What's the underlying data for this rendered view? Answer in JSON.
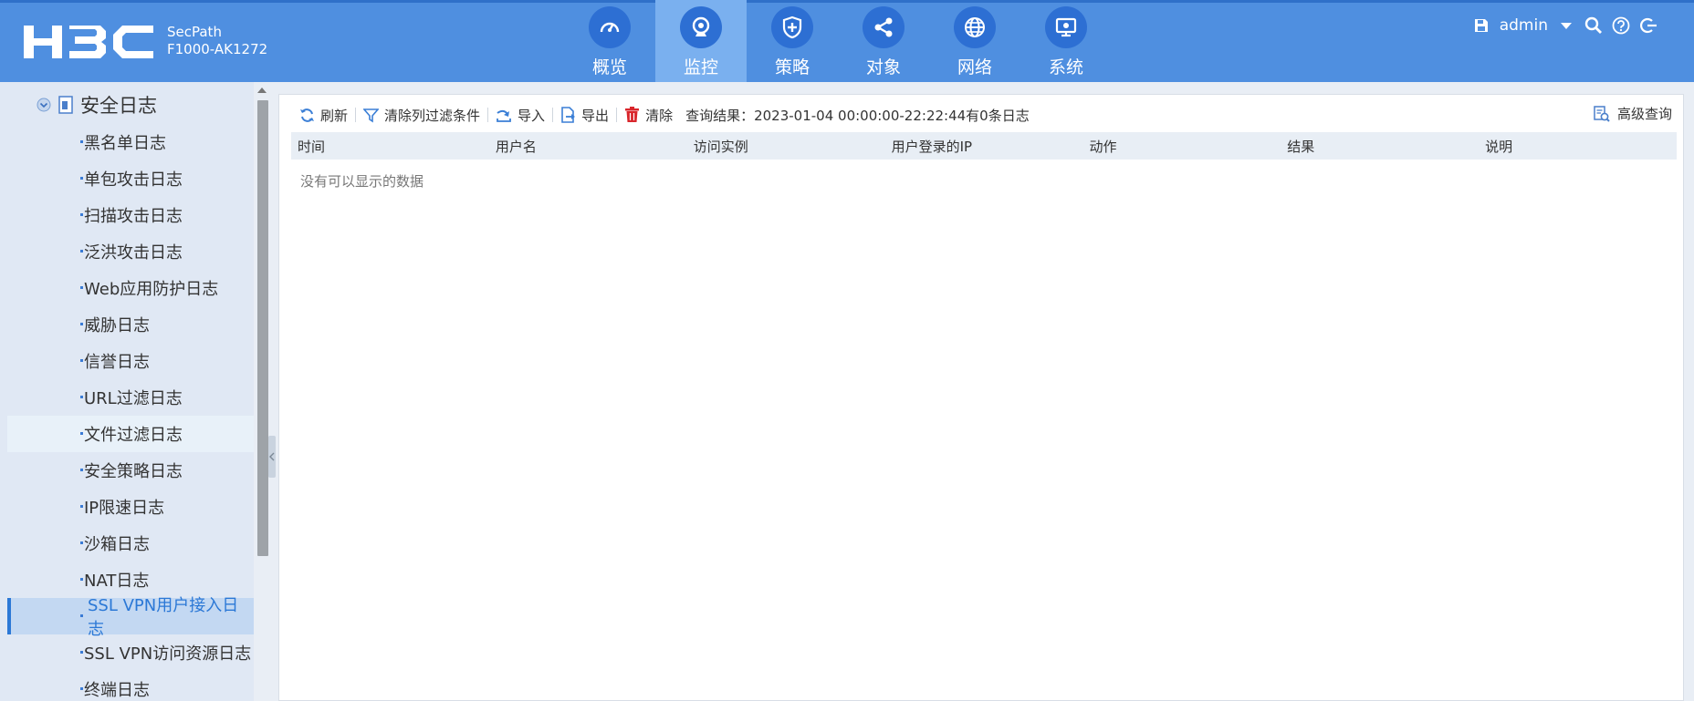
{
  "header": {
    "brand": "H3C",
    "model_line1": "SecPath",
    "model_line2": "F1000-AK1272",
    "nav": [
      {
        "label": "概览",
        "icon": "dashboard-icon"
      },
      {
        "label": "监控",
        "icon": "monitor-camera-icon",
        "active": true
      },
      {
        "label": "策略",
        "icon": "shield-icon"
      },
      {
        "label": "对象",
        "icon": "share-nodes-icon"
      },
      {
        "label": "网络",
        "icon": "globe-icon"
      },
      {
        "label": "系统",
        "icon": "system-screen-icon"
      }
    ],
    "user": "admin"
  },
  "sidebar": {
    "group": "安全日志",
    "items": [
      {
        "label": "黑名单日志"
      },
      {
        "label": "单包攻击日志"
      },
      {
        "label": "扫描攻击日志"
      },
      {
        "label": "泛洪攻击日志"
      },
      {
        "label": "Web应用防护日志"
      },
      {
        "label": "威胁日志"
      },
      {
        "label": "信誉日志"
      },
      {
        "label": "URL过滤日志"
      },
      {
        "label": "文件过滤日志"
      },
      {
        "label": "安全策略日志"
      },
      {
        "label": "IP限速日志"
      },
      {
        "label": "沙箱日志"
      },
      {
        "label": "NAT日志"
      },
      {
        "label": "SSL VPN用户接入日志"
      },
      {
        "label": "SSL VPN访问资源日志"
      },
      {
        "label": "终端日志"
      }
    ],
    "hover_index": 8,
    "selected_index": 13
  },
  "toolbar": {
    "refresh": "刷新",
    "clear_filter": "清除列过滤条件",
    "import": "导入",
    "export": "导出",
    "clear": "清除",
    "query_result": "查询结果：2023-01-04 00:00:00-22:22:44有0条日志",
    "advanced_query": "高级查询"
  },
  "table": {
    "columns": [
      "时间",
      "用户名",
      "访问实例",
      "用户登录的IP",
      "动作",
      "结果",
      "说明"
    ],
    "empty_text": "没有可以显示的数据"
  },
  "colors": {
    "header_bg": "#4f8fe0",
    "nav_active_bg": "#7ab0ef",
    "nav_icon_bg": "#2d6fd3",
    "sidebar_bg": "#e0e8f4",
    "selected_bg": "#c3d8f2",
    "accent": "#2b78d6"
  }
}
